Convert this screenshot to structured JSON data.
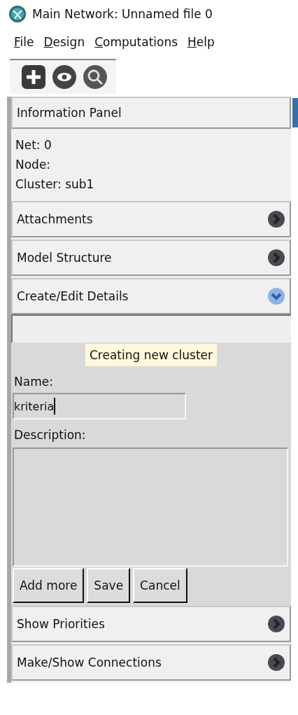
{
  "window": {
    "title": "Main Network: Unnamed file 0"
  },
  "menu": [
    {
      "label": "File",
      "mnemonic": true
    },
    {
      "label": "Design",
      "mnemonic": true
    },
    {
      "label": "Computations",
      "mnemonic": true
    },
    {
      "label": "Help",
      "mnemonic": true
    }
  ],
  "toolbar": [
    {
      "kind": "add"
    },
    {
      "kind": "view"
    },
    {
      "kind": "inspect"
    }
  ],
  "info_panel": {
    "title": "Information Panel",
    "lines": [
      "Net: 0",
      "Node:",
      "Cluster: sub1"
    ]
  },
  "sections": [
    {
      "title": "Attachments",
      "expanded": false
    },
    {
      "title": "Model Structure",
      "expanded": false
    },
    {
      "title": "Create/Edit Details",
      "expanded": true
    },
    {
      "title": "Show Priorities",
      "expanded": false
    },
    {
      "title": "Make/Show Connections",
      "expanded": false
    }
  ],
  "details": {
    "tooltip": "Creating new cluster",
    "name_label": "Name:",
    "name_value": "kriteria",
    "description_label": "Description:",
    "buttons": [
      "Add more",
      "Save",
      "Cancel"
    ]
  }
}
